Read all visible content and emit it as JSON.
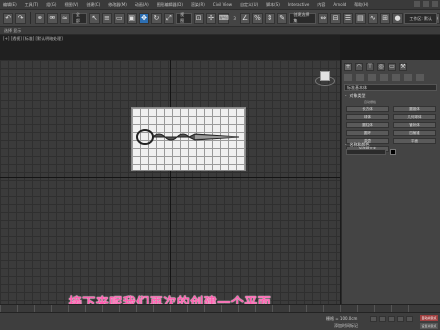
{
  "menubar": {
    "items": [
      "编辑(E)",
      "工具(T)",
      "组(G)",
      "视图(V)",
      "创建(C)",
      "修改器(M)",
      "动画(A)",
      "图形编辑器(D)",
      "渲染(R)",
      "Civil View",
      "自定义(U)",
      "脚本(S)",
      "Interactive",
      "内容",
      "Arnold",
      "帮助(H)"
    ]
  },
  "toolbar": {
    "all_filter": "全部",
    "view_dropdown": "视图",
    "snap_label": "3",
    "angle_snap": "∠",
    "percent_snap": "%",
    "selection_set": "创建选择集",
    "workspace": "工作区: 默认"
  },
  "secondbar": {
    "label": "选择 显示"
  },
  "viewport": {
    "label": "[+] [透视] [标准] [默认明暗处理]"
  },
  "cmdpanel": {
    "category_dropdown": "标准基本体",
    "object_type_title": "对象类型",
    "autogrid_label": "自动栅格",
    "buttons": [
      "长方体",
      "圆锥体",
      "球体",
      "几何球体",
      "圆柱体",
      "管状体",
      "圆环",
      "四棱锥",
      "茶壶",
      "平面",
      "加强型文本"
    ],
    "name_color_title": "名称和颜色"
  },
  "caption": {
    "text": "接下来呢我们再次的创建一个平面"
  },
  "statusbar": {
    "grid": "栅格 = 100.0cm",
    "add_time_tag": "添加时间标记",
    "auto_key": "自动关键点",
    "set_key": "设置关键点"
  },
  "colors": {
    "caption": "#ff5fb0",
    "accent": "#2d6fb3",
    "viewport_bg": "#3b3b3b"
  }
}
